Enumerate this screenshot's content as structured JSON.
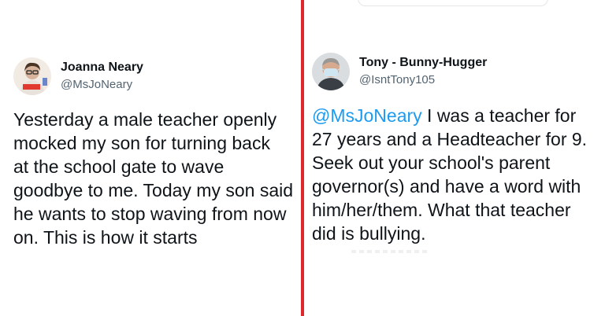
{
  "left_tweet": {
    "display_name": "Joanna Neary",
    "handle": "@MsJoNeary",
    "text": "Yesterday a male teacher openly\nmocked my son for turning back\nat the school gate to wave\ngoodbye to me. Today my son said\nhe wants to stop waving from now\non. This is how it starts"
  },
  "right_tweet": {
    "display_name": "Tony - Bunny-Hugger",
    "handle": "@IsntTony105",
    "mention": "@MsJoNeary",
    "text": " I was a teacher for\n27 years and a Headteacher for 9.\nSeek out your school's parent\ngovernor(s) and have a word with\nhim/her/them. What that teacher\ndid is bullying."
  },
  "colors": {
    "divider": "#e0262b",
    "mention": "#1d9bf0",
    "handle": "#536471",
    "text": "#0f1419"
  }
}
